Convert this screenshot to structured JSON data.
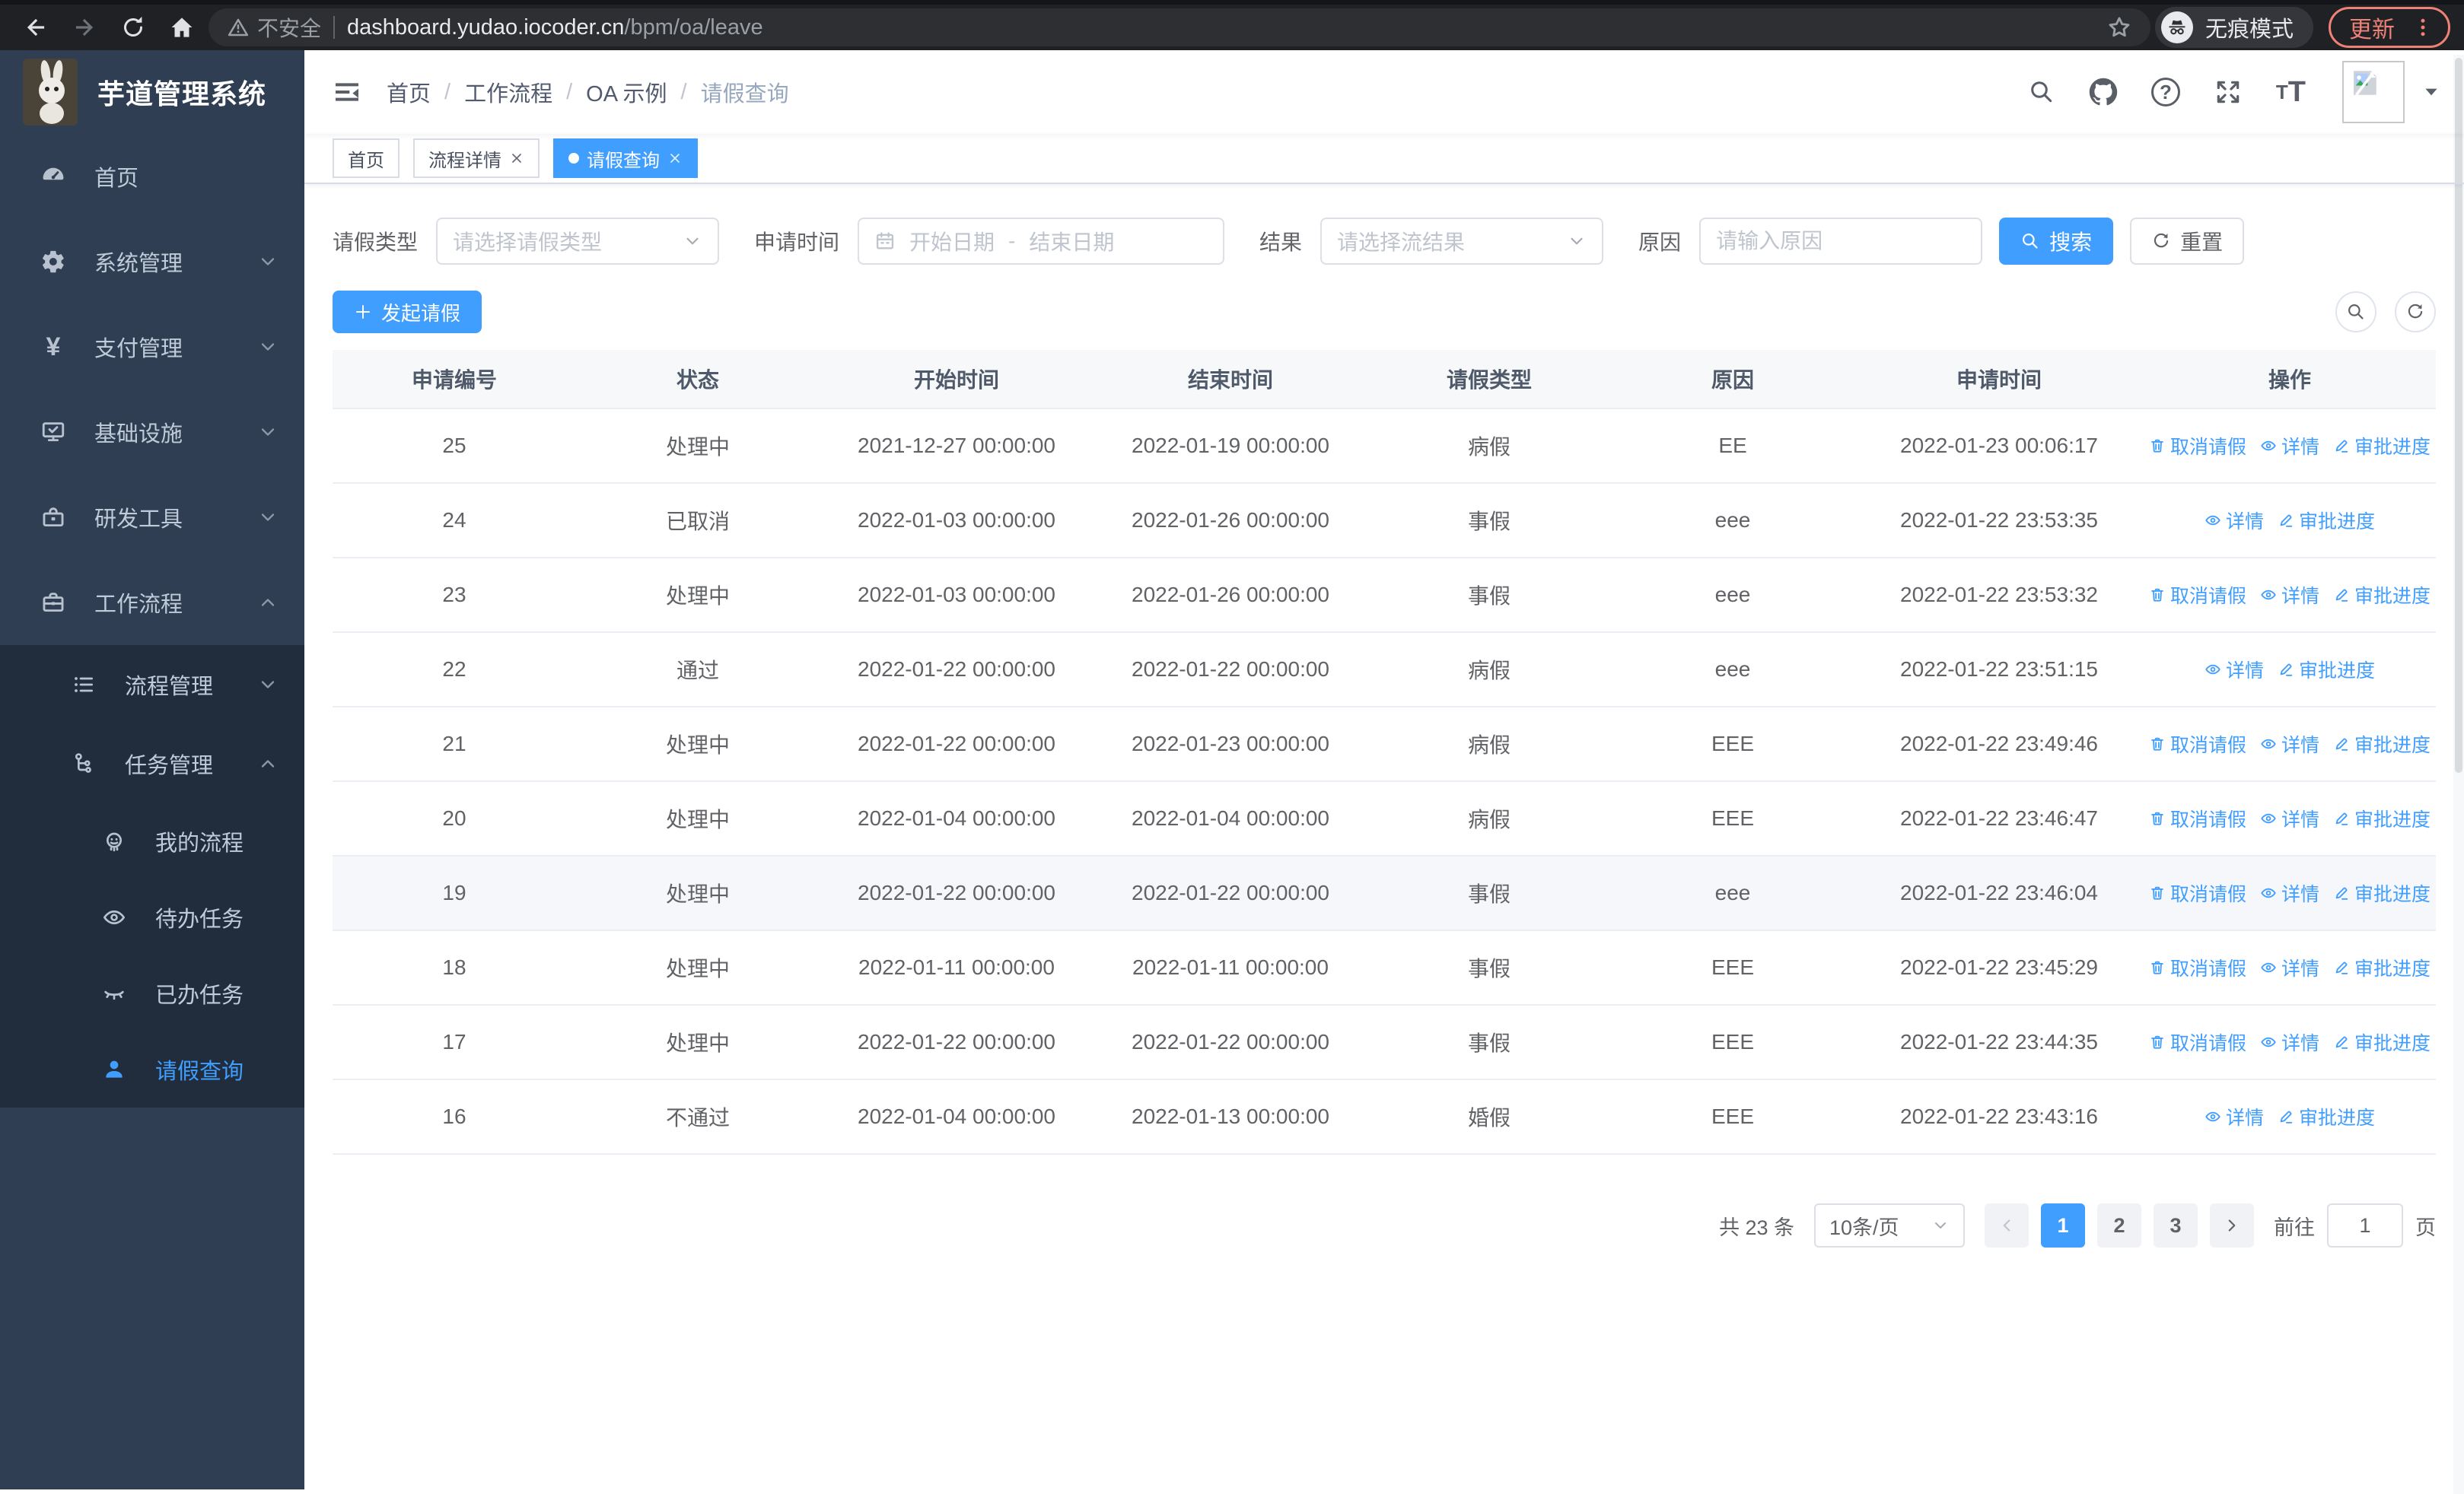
{
  "colors": {
    "primary": "#409EFF",
    "sidebar_bg": "#2f3e53",
    "submenu_bg": "#212d3d",
    "update_accent": "#ee8277"
  },
  "browser": {
    "security_label": "不安全",
    "url_host": "dashboard.yudao.iocoder.cn",
    "url_path": "/bpm/oa/leave",
    "incognito_label": "无痕模式",
    "update_label": "更新"
  },
  "app": {
    "logo_title": "芋道管理系统"
  },
  "breadcrumb": {
    "items": [
      "首页",
      "工作流程",
      "OA 示例",
      "请假查询"
    ]
  },
  "tabs": [
    {
      "label": "首页",
      "closable": false,
      "active": false
    },
    {
      "label": "流程详情",
      "closable": true,
      "active": false
    },
    {
      "label": "请假查询",
      "closable": true,
      "active": true
    }
  ],
  "sidebar": {
    "items": [
      {
        "label": "首页",
        "icon": "dashboard-icon",
        "level": 1
      },
      {
        "label": "系统管理",
        "icon": "gear-icon",
        "level": 1,
        "chevron": "down"
      },
      {
        "label": "支付管理",
        "icon": "yen-icon",
        "level": 1,
        "chevron": "down"
      },
      {
        "label": "基础设施",
        "icon": "monitor-icon",
        "level": 1,
        "chevron": "down"
      },
      {
        "label": "研发工具",
        "icon": "toolbox-icon",
        "level": 1,
        "chevron": "down"
      },
      {
        "label": "工作流程",
        "icon": "briefcase-icon",
        "level": 1,
        "chevron": "up",
        "expanded": true
      },
      {
        "label": "流程管理",
        "icon": "list-icon",
        "level": 2,
        "chevron": "down"
      },
      {
        "label": "任务管理",
        "icon": "org-icon",
        "level": 2,
        "chevron": "up",
        "expanded": true
      },
      {
        "label": "我的流程",
        "icon": "robot-icon",
        "level": 3
      },
      {
        "label": "待办任务",
        "icon": "eye-icon",
        "level": 3
      },
      {
        "label": "已办任务",
        "icon": "eye-closed-icon",
        "level": 3
      },
      {
        "label": "请假查询",
        "icon": "user-icon",
        "level": 3,
        "active": true
      }
    ]
  },
  "filters": {
    "leave_type": {
      "label": "请假类型",
      "placeholder": "请选择请假类型"
    },
    "apply_time": {
      "label": "申请时间",
      "start_placeholder": "开始日期",
      "separator": "-",
      "end_placeholder": "结束日期"
    },
    "result": {
      "label": "结果",
      "placeholder": "请选择流结果"
    },
    "reason": {
      "label": "原因",
      "placeholder": "请输入原因"
    },
    "search_label": "搜索",
    "reset_label": "重置"
  },
  "toolbar": {
    "create_label": "发起请假"
  },
  "table": {
    "headers": [
      "申请编号",
      "状态",
      "开始时间",
      "结束时间",
      "请假类型",
      "原因",
      "申请时间",
      "操作"
    ],
    "action_labels": {
      "cancel": "取消请假",
      "detail": "详情",
      "progress": "审批进度"
    },
    "rows": [
      {
        "id": "25",
        "status": "处理中",
        "start": "2021-12-27 00:00:00",
        "end": "2022-01-19 00:00:00",
        "type": "病假",
        "reason": "EE",
        "apply": "2022-01-23 00:06:17"
      },
      {
        "id": "24",
        "status": "已取消",
        "start": "2022-01-03 00:00:00",
        "end": "2022-01-26 00:00:00",
        "type": "事假",
        "reason": "eee",
        "apply": "2022-01-22 23:53:35"
      },
      {
        "id": "23",
        "status": "处理中",
        "start": "2022-01-03 00:00:00",
        "end": "2022-01-26 00:00:00",
        "type": "事假",
        "reason": "eee",
        "apply": "2022-01-22 23:53:32"
      },
      {
        "id": "22",
        "status": "通过",
        "start": "2022-01-22 00:00:00",
        "end": "2022-01-22 00:00:00",
        "type": "病假",
        "reason": "eee",
        "apply": "2022-01-22 23:51:15"
      },
      {
        "id": "21",
        "status": "处理中",
        "start": "2022-01-22 00:00:00",
        "end": "2022-01-23 00:00:00",
        "type": "病假",
        "reason": "EEE",
        "apply": "2022-01-22 23:49:46"
      },
      {
        "id": "20",
        "status": "处理中",
        "start": "2022-01-04 00:00:00",
        "end": "2022-01-04 00:00:00",
        "type": "病假",
        "reason": "EEE",
        "apply": "2022-01-22 23:46:47"
      },
      {
        "id": "19",
        "status": "处理中",
        "start": "2022-01-22 00:00:00",
        "end": "2022-01-22 00:00:00",
        "type": "事假",
        "reason": "eee",
        "apply": "2022-01-22 23:46:04"
      },
      {
        "id": "18",
        "status": "处理中",
        "start": "2022-01-11 00:00:00",
        "end": "2022-01-11 00:00:00",
        "type": "事假",
        "reason": "EEE",
        "apply": "2022-01-22 23:45:29"
      },
      {
        "id": "17",
        "status": "处理中",
        "start": "2022-01-22 00:00:00",
        "end": "2022-01-22 00:00:00",
        "type": "事假",
        "reason": "EEE",
        "apply": "2022-01-22 23:44:35"
      },
      {
        "id": "16",
        "status": "不通过",
        "start": "2022-01-04 00:00:00",
        "end": "2022-01-13 00:00:00",
        "type": "婚假",
        "reason": "EEE",
        "apply": "2022-01-22 23:43:16"
      }
    ]
  },
  "pagination": {
    "total_text": "共 23 条",
    "page_size": "10条/页",
    "pages": [
      "1",
      "2",
      "3"
    ],
    "active_page": "1",
    "goto_label": "前往",
    "goto_value": "1",
    "goto_suffix": "页"
  },
  "glyphs": {
    "yen": "¥",
    "question": "?",
    "font_size_small": "T",
    "font_size_large": "T"
  }
}
